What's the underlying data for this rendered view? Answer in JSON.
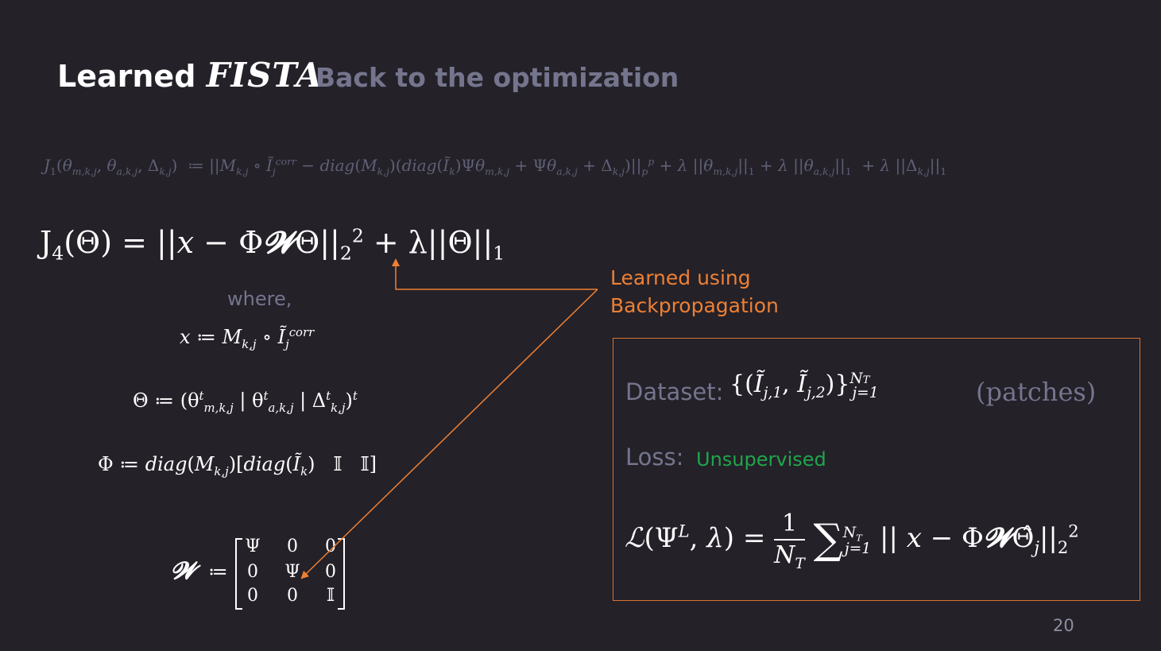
{
  "slide": {
    "title": "Learned",
    "title_method": "FISTA",
    "subtitle": "Back to the optimization",
    "j1_equation": "J₁(θm,k,j, θa,k,j, Δk,j) ≔ ||Mk,j ∘ Ĩjcorr − diag(Mk,j)(diag(Ĩk)Ψθm,k,j + Ψθa,k,j + Δk,j)||pp + λ ||θm,k,j||₁ + λ ||θa,k,j||₁ + λ ||Δk,j||₁",
    "j4_equation": "J₄(Θ) = ||x − Φ𝓦Θ||²₂ + λ||Θ||₁",
    "where_label": "where,",
    "def_x": "x ≔ Mk,j ∘ Ĩjcorr",
    "def_theta": "Θ ≔ (θtm,k,j | θta,k,j | Δtk,j)t",
    "def_phi": "Φ ≔ diag(Mk,j)[diag(Ĩk)   𝕀   𝕀]",
    "w_symbol": "𝓦",
    "w_assign": "≔",
    "w_matrix": [
      [
        "Ψ",
        "0",
        "0"
      ],
      [
        "0",
        "Ψ",
        "0"
      ],
      [
        "0",
        "0",
        "𝕀"
      ]
    ],
    "annotation": [
      "Learned using",
      "Backpropagation"
    ],
    "box": {
      "dataset_label": "Dataset:",
      "dataset_set": "{(Ĩj,1, Ĩj,2)} j=1 → NT",
      "patches": "(patches)",
      "loss_label": "Loss:",
      "loss_value": "Unsupervised",
      "loss_equation": "ℒ(ΨL, λ) = 1/NT Σj=1..NT || x − Φ𝓦Θ̂j ||²₂"
    },
    "page_number": "20"
  },
  "colors": {
    "background": "#242129",
    "muted": "#74758d",
    "accent_orange": "#ee8033",
    "accent_green": "#1fa64a"
  }
}
